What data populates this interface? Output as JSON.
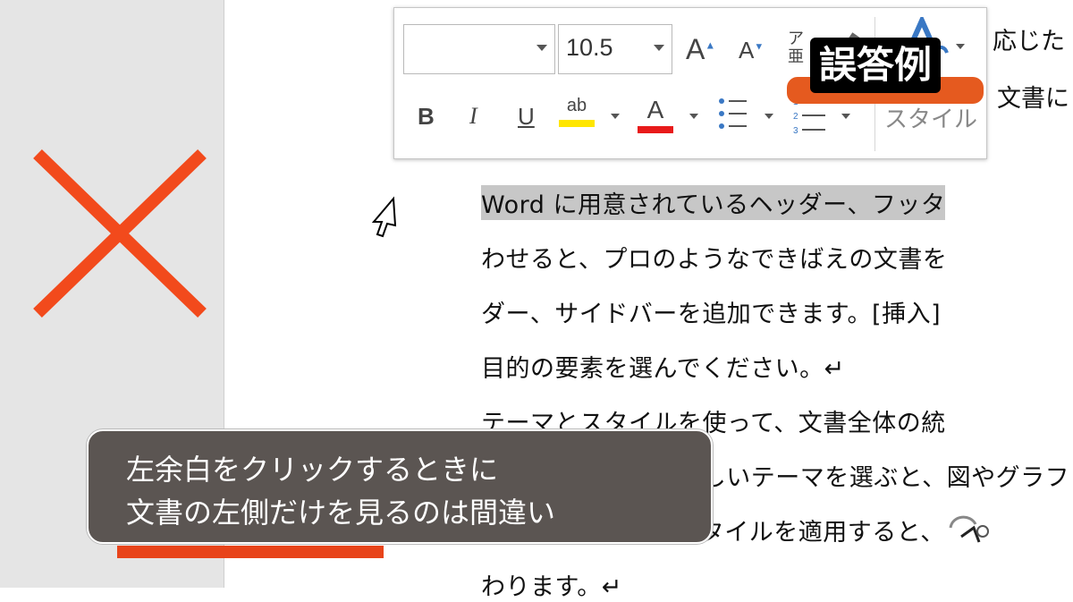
{
  "toolbar": {
    "font_name": "",
    "font_size": "10.5",
    "grow_font": "A",
    "shrink_font": "A",
    "phonetic_top": "ア",
    "phonetic_bottom": "亜",
    "styles_label": "スタイル",
    "bold": "B",
    "italic": "I",
    "underline": "U",
    "highlight": "ab",
    "font_color": "A"
  },
  "overlay": {
    "badge_label": "誤答例",
    "caption_line1": "左余白をクリックするときに",
    "caption_line2": "文書の左側だけを見るのは間違い"
  },
  "document": {
    "partial_top1": "応じた",
    "partial_top2": "文書に",
    "lines": [
      "Word に用意されているヘッダー、フッタ",
      "わせると、プロのようなできばえの文書を",
      "ダー、サイドバーを追加できます。[挿入]",
      "目的の要素を選んでください。↵",
      "テーマとスタイルを使って、文書全体の統",
      "マをクリックして新しいテーマを選ぶと、図やグラフ",
      "せて変わります。スタイルを適用すると、",
      "わります。↵"
    ]
  },
  "colors": {
    "x_mark": "#f24a1c",
    "badge": "#e55a1f",
    "caption_bg": "#5b5552",
    "underline": "#e8441a",
    "highlight_bar": "#ffe600",
    "font_color_bar": "#e81a1a"
  }
}
